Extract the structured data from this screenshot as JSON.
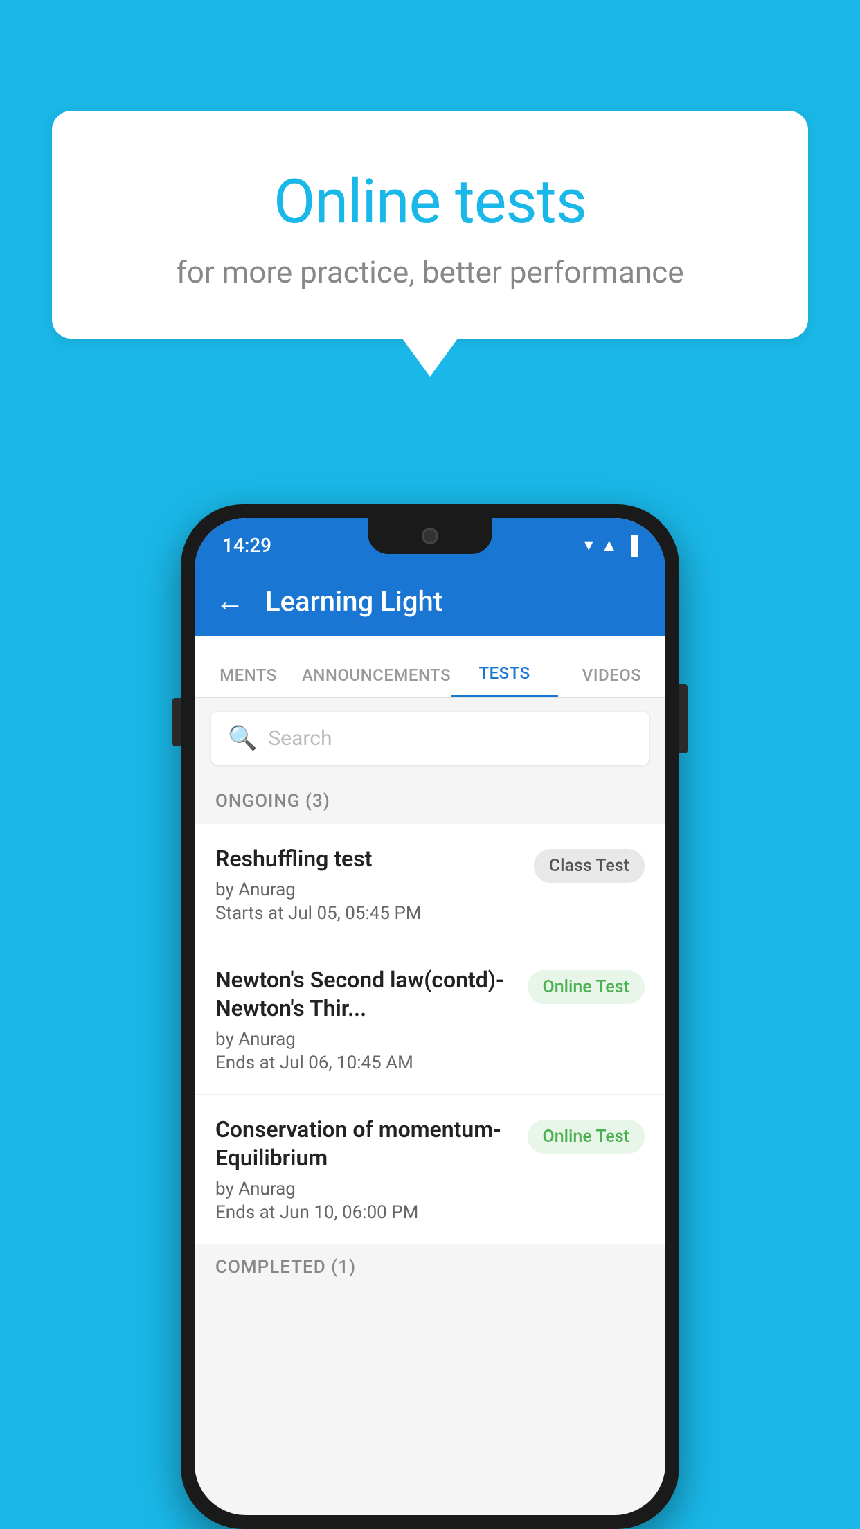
{
  "background_color": "#1ab8e8",
  "speech_bubble": {
    "title": "Online tests",
    "subtitle": "for more practice, better performance"
  },
  "status_bar": {
    "time": "14:29",
    "wifi": "▼",
    "signal": "▲",
    "battery": "▐"
  },
  "app_bar": {
    "back_icon": "←",
    "title": "Learning Light"
  },
  "tabs": [
    {
      "label": "MENTS",
      "active": false
    },
    {
      "label": "ANNOUNCEMENTS",
      "active": false
    },
    {
      "label": "TESTS",
      "active": true
    },
    {
      "label": "VIDEOS",
      "active": false
    }
  ],
  "search": {
    "placeholder": "Search",
    "icon": "🔍"
  },
  "ongoing_section": {
    "label": "ONGOING (3)"
  },
  "tests": [
    {
      "title": "Reshuffling test",
      "author": "by Anurag",
      "date": "Starts at  Jul 05, 05:45 PM",
      "badge": "Class Test",
      "badge_type": "class"
    },
    {
      "title": "Newton's Second law(contd)-Newton's Thir...",
      "author": "by Anurag",
      "date": "Ends at  Jul 06, 10:45 AM",
      "badge": "Online Test",
      "badge_type": "online"
    },
    {
      "title": "Conservation of momentum-Equilibrium",
      "author": "by Anurag",
      "date": "Ends at  Jun 10, 06:00 PM",
      "badge": "Online Test",
      "badge_type": "online"
    }
  ],
  "completed_section": {
    "label": "COMPLETED (1)"
  }
}
